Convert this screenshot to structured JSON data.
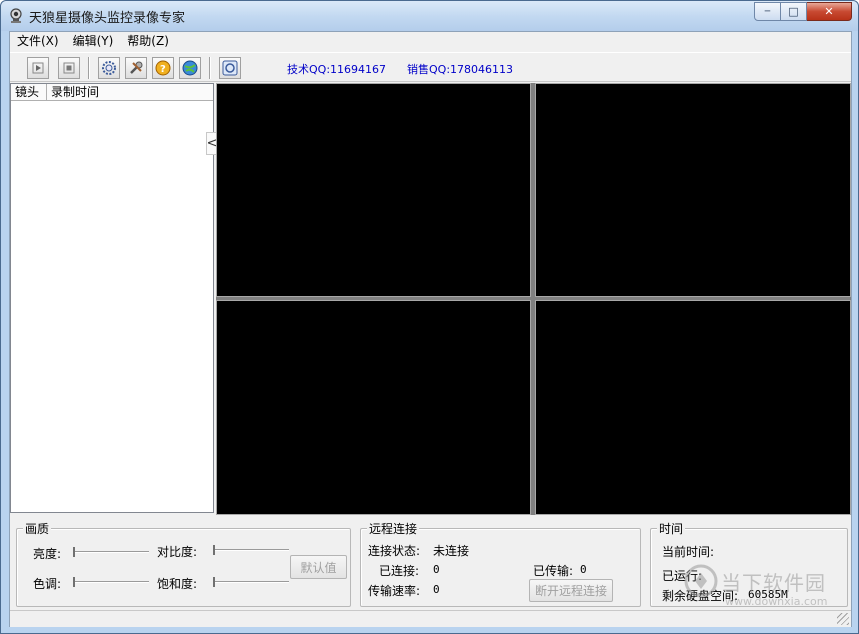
{
  "window": {
    "title": "天狼星摄像头监控录像专家",
    "buttons": {
      "minimize": "─",
      "maximize": "□",
      "close": "✕"
    }
  },
  "menu": [
    {
      "label": "文件(X)"
    },
    {
      "label": "编辑(Y)"
    },
    {
      "label": "帮助(Z)"
    }
  ],
  "toolbar": {
    "icons": [
      "play-icon",
      "stop-icon",
      "settings-gear-icon",
      "tools-icon",
      "help-icon",
      "network-globe-icon",
      "refresh-icon"
    ],
    "tech_qq": "技术QQ:11694167",
    "sales_qq": "销售QQ:178046113",
    "qq_color": "#0000c8"
  },
  "list": {
    "columns": [
      "镜头",
      "录制时间"
    ],
    "collapse_label": "<<"
  },
  "video": {
    "cameras": 4,
    "background": "#000000"
  },
  "quality": {
    "title": "画质",
    "brightness_label": "亮度:",
    "contrast_label": "对比度:",
    "hue_label": "色调:",
    "saturation_label": "饱和度:",
    "default_button": "默认值"
  },
  "remote": {
    "title": "远程连接",
    "status_label": "连接状态:",
    "status_value": "未连接",
    "connected_label": "已连接:",
    "connected_value": "0",
    "transferred_label": "已传输:",
    "transferred_value": "0",
    "rate_label": "传输速率:",
    "rate_value": "0",
    "disconnect_button": "断开远程连接"
  },
  "time": {
    "title": "时间",
    "current_label": "当前时间:",
    "running_label": "已运行:",
    "disk_label": "剩余硬盘空间:",
    "disk_value": "60585M"
  },
  "watermark": {
    "main": "当下软件园",
    "sub": "www.downxia.com"
  }
}
